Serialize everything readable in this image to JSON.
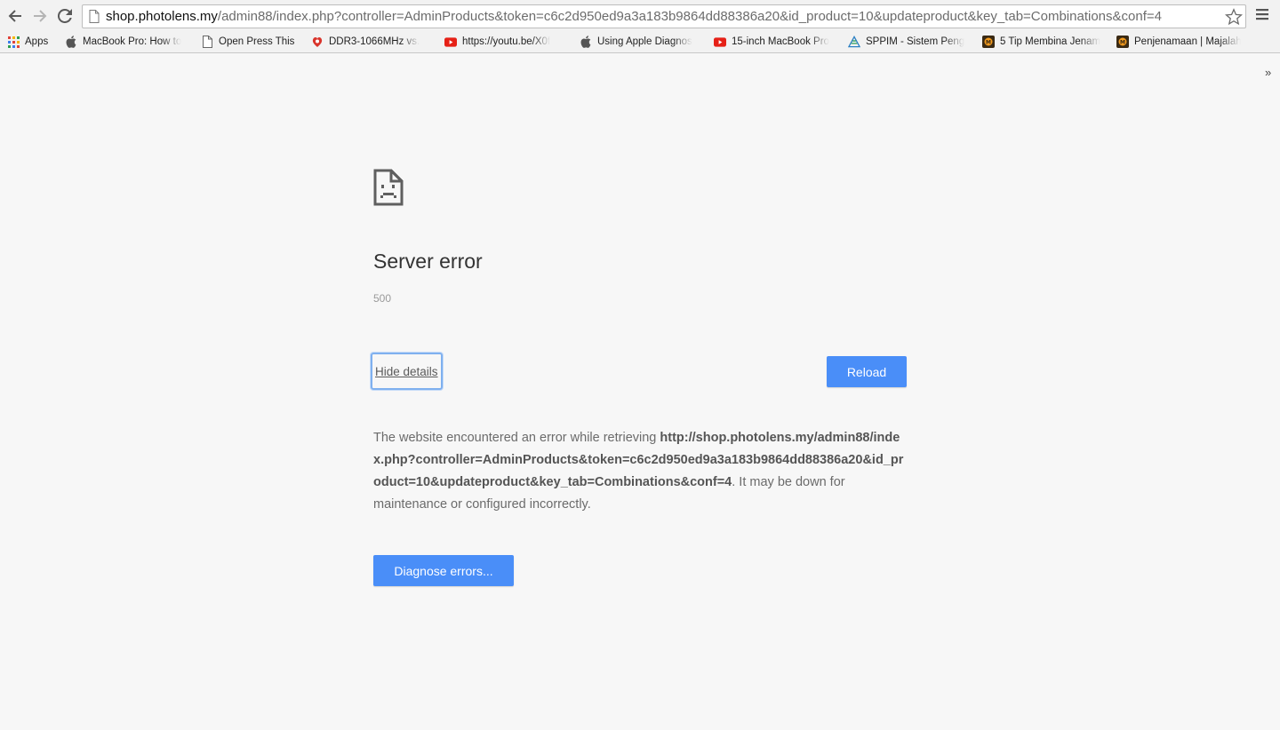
{
  "browser": {
    "url_host": "shop.photolens.my",
    "url_path": "/admin88/index.php?controller=AdminProducts&token=c6c2d950ed9a3a183b9864dd88386a20&id_product=10&updateproduct&key_tab=Combinations&conf=4",
    "bookmarks": [
      {
        "label": "Apps",
        "icon": "apps-grid-icon"
      },
      {
        "label": "MacBook Pro: How to",
        "icon": "apple-icon"
      },
      {
        "label": "Open Press This",
        "icon": "page-icon"
      },
      {
        "label": "DDR3-1066MHz vs.",
        "icon": "site-favicon"
      },
      {
        "label": "https://youtu.be/X0f",
        "icon": "youtube-icon"
      },
      {
        "label": "Using Apple Diagnos",
        "icon": "apple-icon"
      },
      {
        "label": "15-inch MacBook Pro",
        "icon": "youtube-icon"
      },
      {
        "label": "SPPIM - Sistem Peng",
        "icon": "sppim-icon"
      },
      {
        "label": "5 Tip Membina Jenam",
        "icon": "majalah-icon"
      },
      {
        "label": "Penjenamaan | Majalah",
        "icon": "majalah-icon"
      }
    ],
    "more_label": "»"
  },
  "error": {
    "title": "Server error",
    "code": "500",
    "hide_details_label": "Hide details",
    "reload_label": "Reload",
    "details_prefix": "The website encountered an error while retrieving ",
    "details_url": "http://shop.photolens.my/admin88/index.php?controller=AdminProducts&token=c6c2d950ed9a3a183b9864dd88386a20&id_product=10&updateproduct&key_tab=Combinations&conf=4",
    "details_suffix": ". It may be down for maintenance or configured incorrectly.",
    "diagnose_label": "Diagnose errors..."
  },
  "colors": {
    "button_blue": "#4a8ef8",
    "page_background": "#f7f7f7"
  }
}
